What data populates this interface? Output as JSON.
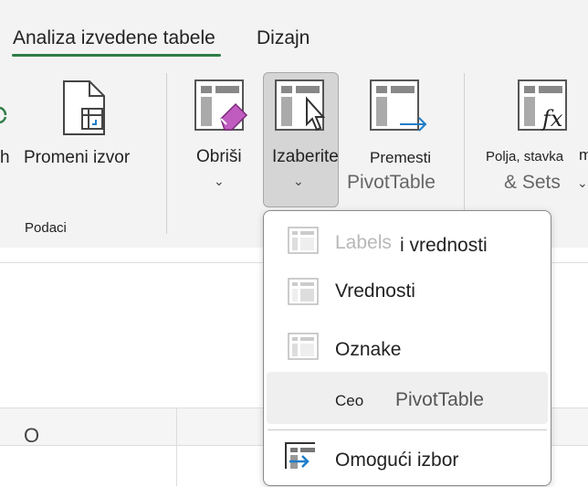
{
  "tabs": [
    {
      "label": "Analiza izvedene tabele",
      "active": true
    },
    {
      "label": "Dizajn",
      "active": false
    }
  ],
  "ribbon": {
    "cut_left_label": "h",
    "change_source": "Promeni izvor",
    "group_data": "Podaci",
    "clear": "Obriši",
    "select": "Izaberite",
    "move_line1": "Premesti",
    "move_line2": "PivotTable",
    "fields_line1": "Polja, stavka",
    "fields_cut": "m",
    "fields_line2": "& Sets"
  },
  "grid": {
    "column_letter": "O"
  },
  "menu": {
    "items": [
      {
        "label": "Labels",
        "label_suffix": "i vrednosti",
        "disabled_part": true
      },
      {
        "label": "Vrednosti"
      },
      {
        "label": "Oznake"
      },
      {
        "label": "Ceo",
        "label_suffix": "PivotTable",
        "highlighted": true
      },
      {
        "label": "Omogući izbor"
      }
    ]
  },
  "colors": {
    "accent_green": "#2e7d46",
    "purple": "#b03bb0",
    "blue": "#1e7dc8"
  }
}
